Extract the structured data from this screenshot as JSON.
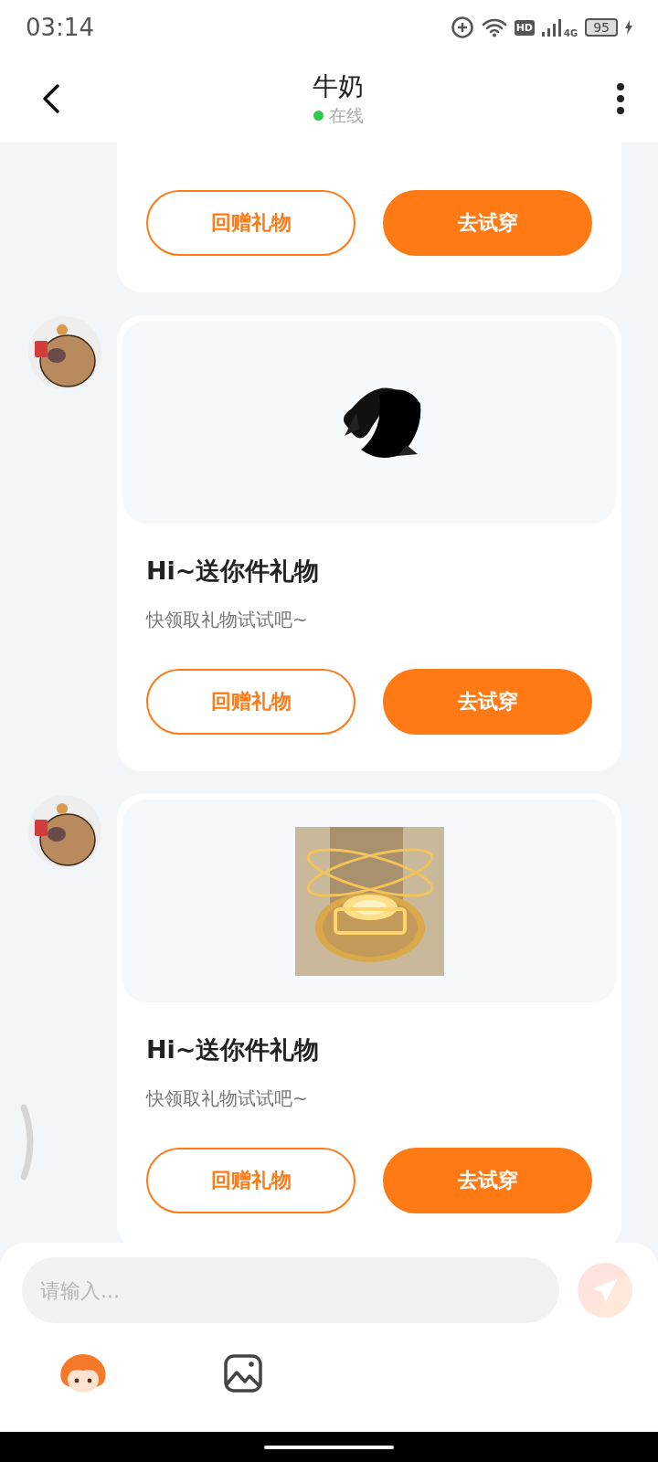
{
  "status_bar": {
    "time": "03:14",
    "hd": "HD",
    "network": "4G",
    "battery": "95"
  },
  "header": {
    "title": "牛奶",
    "status": "在线",
    "online": true
  },
  "messages": [
    {
      "kind": "cut",
      "buttons": [
        {
          "label": "回赠礼物",
          "kind": "outline"
        },
        {
          "label": "去试穿",
          "kind": "filled"
        }
      ]
    },
    {
      "kind": "gift",
      "title": "Hi~送你件礼物",
      "subtitle": "快领取礼物试试吧~",
      "buttons": [
        {
          "label": "回赠礼物",
          "kind": "outline"
        },
        {
          "label": "去试穿",
          "kind": "filled"
        }
      ]
    },
    {
      "kind": "gift",
      "title": "Hi~送你件礼物",
      "subtitle": "快领取礼物试试吧~",
      "buttons": [
        {
          "label": "回赠礼物",
          "kind": "outline"
        },
        {
          "label": "去试穿",
          "kind": "filled"
        }
      ]
    }
  ],
  "composer": {
    "placeholder": "请输入...",
    "send_disabled": true
  }
}
